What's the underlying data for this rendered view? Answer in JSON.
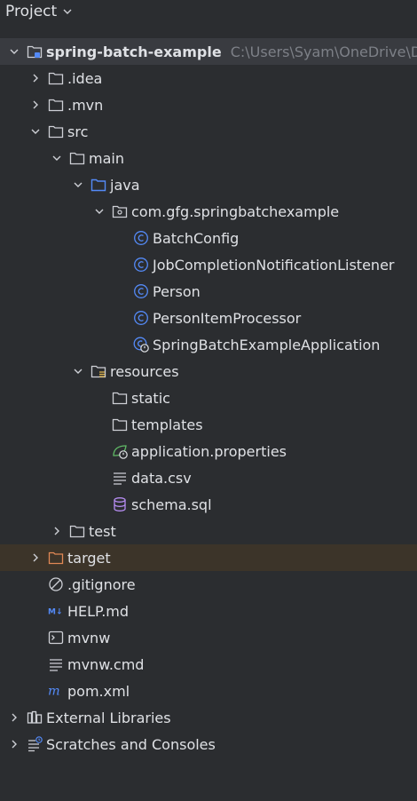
{
  "header": {
    "title": "Project"
  },
  "root": {
    "label": "spring-batch-example",
    "path": "C:\\Users\\Syam\\OneDrive\\De"
  },
  "nodes": {
    "idea": ".idea",
    "mvn": ".mvn",
    "src": "src",
    "main": "main",
    "java": "java",
    "package": "com.gfg.springbatchexample",
    "batchconfig": "BatchConfig",
    "listener": "JobCompletionNotificationListener",
    "person": "Person",
    "processor": "PersonItemProcessor",
    "application": "SpringBatchExampleApplication",
    "resources": "resources",
    "static": "static",
    "templates": "templates",
    "appprops": "application.properties",
    "datacsv": "data.csv",
    "schema": "schema.sql",
    "test": "test",
    "target": "target",
    "gitignore": ".gitignore",
    "helpmd": "HELP.md",
    "mvnw": "mvnw",
    "mvnwcmd": "mvnw.cmd",
    "pom": "pom.xml",
    "extlibs": "External Libraries",
    "scratches": "Scratches and Consoles"
  },
  "colors": {
    "background": "#2b2d30",
    "selected_row": "#393b40",
    "excluded_row": "#3c3429",
    "text": "#dfe1e5",
    "path_text": "#7d8087",
    "class_icon": "#548af7",
    "folder_icon": "#ced0d6",
    "source_folder_icon": "#548af7",
    "excluded_folder_icon": "#e08855",
    "spring_icon": "#5fb865",
    "sql_icon": "#b58cf1"
  }
}
